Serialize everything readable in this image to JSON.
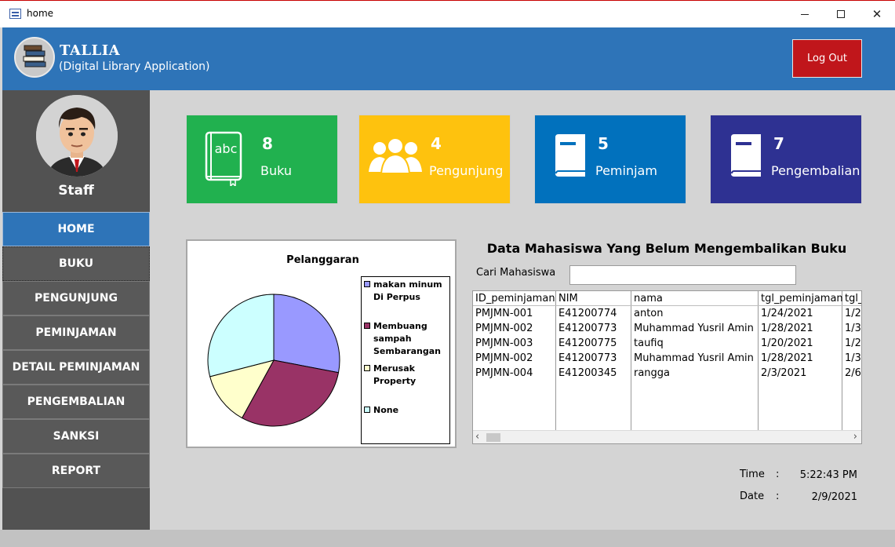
{
  "window": {
    "title": "home"
  },
  "header": {
    "brand": "TALLIA",
    "subtitle": "(Digital Library Application)",
    "logout_label": "Log Out"
  },
  "sidebar": {
    "role": "Staff",
    "items": [
      {
        "label": "HOME"
      },
      {
        "label": "BUKU"
      },
      {
        "label": "PENGUNJUNG"
      },
      {
        "label": "PEMINJAMAN"
      },
      {
        "label": "DETAIL PEMINJAMAN"
      },
      {
        "label": "PENGEMBALIAN"
      },
      {
        "label": "SANKSI"
      },
      {
        "label": "REPORT"
      }
    ]
  },
  "cards": [
    {
      "value": "8",
      "label": "Buku",
      "color": "#21b14f",
      "icon": "book-abc-icon"
    },
    {
      "value": "4",
      "label": "Pengunjung",
      "color": "#fec20e",
      "icon": "people-icon"
    },
    {
      "value": "5",
      "label": "Peminjam",
      "color": "#0171bd",
      "icon": "book-icon"
    },
    {
      "value": "7",
      "label": "Pengembalian",
      "color": "#2e3192",
      "icon": "book-icon"
    }
  ],
  "chart_data": {
    "type": "pie",
    "title": "Pelanggaran",
    "categories": [
      "makan minum Di Perpus",
      "Membuang sampah Sembarangan",
      "Merusak Property",
      "None"
    ],
    "values": [
      28,
      30,
      13,
      29
    ],
    "colors": [
      "#9999ff",
      "#993366",
      "#ffffcc",
      "#ccffff"
    ],
    "legend_position": "right"
  },
  "table": {
    "title": "Data Mahasiswa Yang Belum Mengembalikan Buku",
    "search_label": "Cari Mahasiswa",
    "search_value": "",
    "columns": [
      "ID_peminjaman",
      "NIM",
      "nama",
      "tgl_peminjaman",
      "tgl_"
    ],
    "rows": [
      [
        "PMJMN-001",
        "E41200774",
        "anton",
        "1/24/2021",
        "1/2"
      ],
      [
        "PMJMN-002",
        "E41200773",
        "Muhammad Yusril Amin",
        "1/28/2021",
        "1/3"
      ],
      [
        "PMJMN-003",
        "E41200775",
        "taufiq",
        "1/20/2021",
        "1/2"
      ],
      [
        "PMJMN-002",
        "E41200773",
        "Muhammad Yusril Amin",
        "1/28/2021",
        "1/3"
      ],
      [
        "PMJMN-004",
        "E41200345",
        "rangga",
        "2/3/2021",
        "2/6"
      ]
    ]
  },
  "clock": {
    "time_label": "Time",
    "time_value": "5:22:43 PM",
    "date_label": "Date",
    "date_value": "2/9/2021",
    "separator": ":"
  }
}
